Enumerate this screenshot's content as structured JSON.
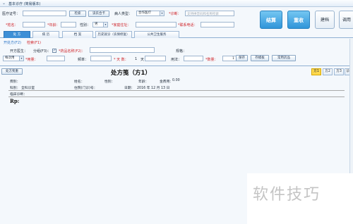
{
  "window": {
    "title": "基本诊疗 (简易版本)"
  },
  "header": {
    "card_no_label": "医疗证号：",
    "search_btn": "检索",
    "read_card_btn": "读农合卡",
    "patient_type_label": "病人类型：",
    "patient_type_value": "合作医疗",
    "diagnosis_label": "*诊断：",
    "diagnosis_placeholder": "支持拼音码和名称检索",
    "name_label": "*姓名：",
    "age_label": "*年龄：",
    "gender_label": "性别：",
    "gender_value": "男",
    "address_label": "*家庭住址：",
    "phone_label": "*联系电话："
  },
  "actions": {
    "settle": "结算",
    "reset": "重收",
    "build_record": "建档",
    "use": "调用"
  },
  "tabs": [
    "处    方",
    "病    历",
    "档    案",
    "历史就诊（农保修复）",
    "公共卫生服务"
  ],
  "prescribe": {
    "section": "开处方(F2)",
    "section_alt": "检索(F1)",
    "doctor_label": "开方医生：",
    "split_label": "分组(F3)：",
    "split_checked": "✓",
    "drug_label": "*药品名称(F2)：",
    "spec_label": "规格：",
    "dose_unit_value": "每次用",
    "dose_label": "*用量：",
    "freq_label": "频率：",
    "days_label": "* 天  数：",
    "days_value": "1",
    "days_unit": "天",
    "usage_label": "用法：",
    "qty_label": "*数量：",
    "qty_value": "1",
    "save_btn": "保存",
    "template_btn": "存模板",
    "common_drug_btn": "常用药品"
  },
  "rx": {
    "sheet_btn": "处方笺重",
    "title": "处方笺（方1）",
    "pages": [
      "方1",
      "方2",
      "方3",
      "诊疗"
    ],
    "fee_label": "费别：",
    "name_label": "姓名：",
    "gender_label": "性别：",
    "age_label": "年龄：",
    "total_label": "金费用：",
    "total_value": "0.00",
    "dept_label": "科别：",
    "dept_value": "全科诊室",
    "visit_label": "住院(门诊)号：",
    "date_label": "日期：",
    "date_value": "2016  年  12  月  13  日",
    "clinical_label": "临床诊断：",
    "rp": "Rp:"
  },
  "watermark": "软件技巧"
}
